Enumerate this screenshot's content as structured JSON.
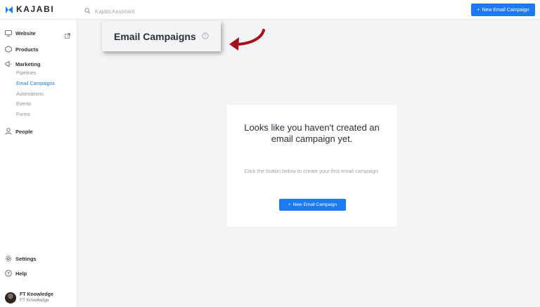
{
  "header": {
    "logo_text": "KAJABI",
    "search": {
      "placeholder": "Kajabi Assistant",
      "icon": "search-icon"
    },
    "new_campaign_button": "New Email Campaign",
    "accent_color": "#1c7bf2"
  },
  "sidebar": {
    "website": {
      "label": "Website",
      "icon": "monitor-icon",
      "link_icon": "external-link-icon"
    },
    "products": {
      "label": "Products",
      "icon": "products-icon"
    },
    "marketing": {
      "label": "Marketing",
      "icon": "marketing-icon",
      "items": [
        {
          "label": "Pipelines",
          "active": false
        },
        {
          "label": "Email Campaigns",
          "active": true
        },
        {
          "label": "Automations",
          "active": false
        },
        {
          "label": "Events",
          "active": false
        },
        {
          "label": "Forms",
          "active": false
        }
      ]
    },
    "people": {
      "label": "People",
      "icon": "person-icon"
    },
    "settings": {
      "label": "Settings",
      "icon": "gear-icon"
    },
    "help": {
      "label": "Help",
      "icon": "help-icon"
    },
    "user": {
      "name": "FT Knowledge",
      "site": "FT Knowledge"
    }
  },
  "main": {
    "page_title": "Email Campaigns",
    "title_help_icon": "question-circle-icon",
    "empty_state": {
      "heading": "Looks like you haven't created an email campaign yet.",
      "text": "Click the button below to create your first email campaign.",
      "button": "New Email Campaign"
    }
  }
}
